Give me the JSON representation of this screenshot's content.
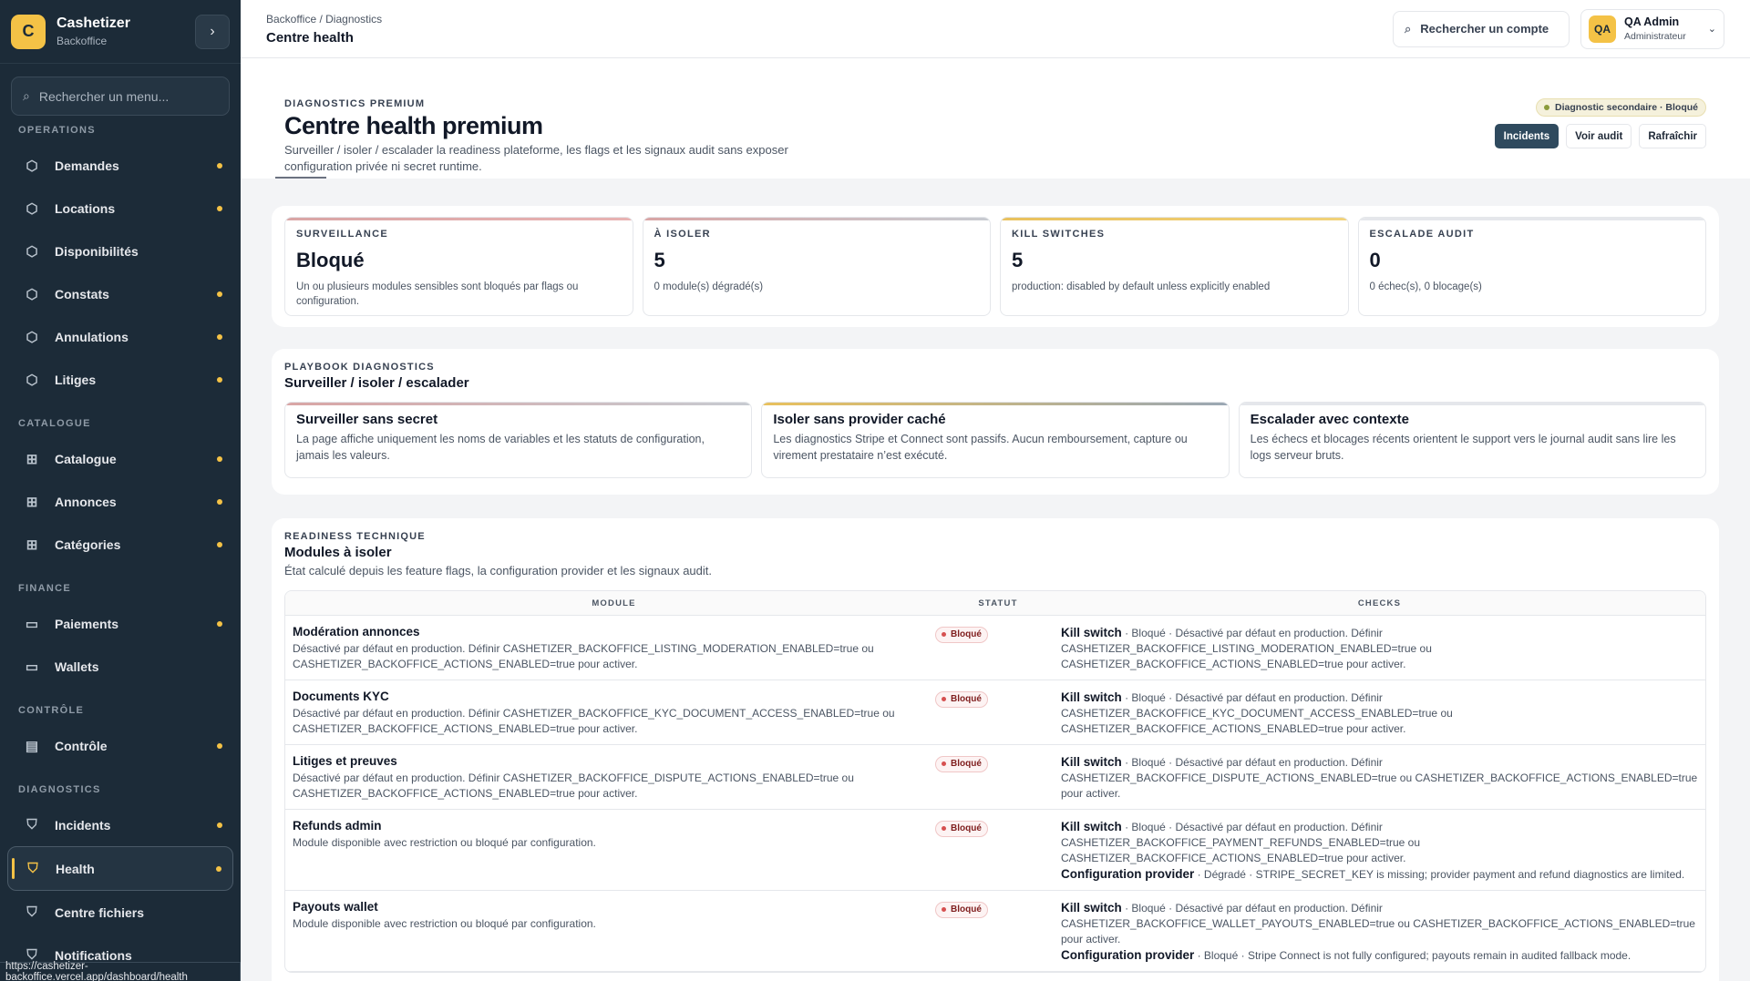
{
  "brand": {
    "initial": "C",
    "name": "Cashetizer",
    "sub": "Backoffice"
  },
  "sidebar": {
    "search_placeholder": "Rechercher un menu...",
    "sections": [
      {
        "title": "OPERATIONS",
        "items": [
          {
            "label": "Demandes",
            "icon": "cube-icon",
            "dot": true
          },
          {
            "label": "Locations",
            "icon": "cube-icon",
            "dot": true
          },
          {
            "label": "Disponibilités",
            "icon": "cube-icon",
            "dot": false
          },
          {
            "label": "Constats",
            "icon": "cube-icon",
            "dot": true
          },
          {
            "label": "Annulations",
            "icon": "cube-icon",
            "dot": true
          },
          {
            "label": "Litiges",
            "icon": "cube-icon",
            "dot": true
          }
        ]
      },
      {
        "title": "CATALOGUE",
        "items": [
          {
            "label": "Catalogue",
            "icon": "grid-icon",
            "dot": true
          },
          {
            "label": "Annonces",
            "icon": "grid-icon",
            "dot": true
          },
          {
            "label": "Catégories",
            "icon": "grid-icon",
            "dot": true
          }
        ]
      },
      {
        "title": "FINANCE",
        "items": [
          {
            "label": "Paiements",
            "icon": "card-icon",
            "dot": true
          },
          {
            "label": "Wallets",
            "icon": "card-icon",
            "dot": false
          }
        ]
      },
      {
        "title": "CONTRÔLE",
        "items": [
          {
            "label": "Contrôle",
            "icon": "document-icon",
            "dot": true
          }
        ]
      },
      {
        "title": "DIAGNOSTICS",
        "items": [
          {
            "label": "Incidents",
            "icon": "shield-icon",
            "dot": true
          },
          {
            "label": "Health",
            "icon": "shield-heart-icon",
            "dot": true,
            "active": true
          },
          {
            "label": "Centre fichiers",
            "icon": "shield-icon",
            "dot": false
          },
          {
            "label": "Notifications",
            "icon": "shield-icon",
            "dot": false
          }
        ]
      }
    ]
  },
  "status_url": "https://cashetizer-backoffice.vercel.app/dashboard/health",
  "topbar": {
    "breadcrumb": "Backoffice  /  Diagnostics",
    "title": "Centre health",
    "account_search": "Rechercher un compte",
    "user": {
      "initials": "QA",
      "name": "QA Admin",
      "role": "Administrateur"
    }
  },
  "hero": {
    "eyebrow": "DIAGNOSTICS PREMIUM",
    "title": "Centre health premium",
    "desc": "Surveiller / isoler / escalader la readiness plateforme, les flags et les signaux audit sans exposer configuration privée ni secret runtime.",
    "status_pill": "Diagnostic secondaire · Bloqué",
    "buttons": {
      "incidents": "Incidents",
      "audit": "Voir audit",
      "refresh": "Rafraîchir"
    }
  },
  "kpis": [
    {
      "label": "SURVEILLANCE",
      "value": "Bloqué",
      "note": "Un ou plusieurs modules sensibles sont bloqués par flags ou configuration."
    },
    {
      "label": "À ISOLER",
      "value": "5",
      "note": "0 module(s) dégradé(s)"
    },
    {
      "label": "KILL SWITCHES",
      "value": "5",
      "note": "production: disabled by default unless explicitly enabled"
    },
    {
      "label": "ESCALADE AUDIT",
      "value": "0",
      "note": "0 échec(s), 0 blocage(s)"
    }
  ],
  "playbook": {
    "eyebrow": "PLAYBOOK DIAGNOSTICS",
    "title": "Surveiller / isoler / escalader",
    "cards": [
      {
        "title": "Surveiller sans secret",
        "text": "La page affiche uniquement les noms de variables et les statuts de configuration, jamais les valeurs."
      },
      {
        "title": "Isoler sans provider caché",
        "text": "Les diagnostics Stripe et Connect sont passifs. Aucun remboursement, capture ou virement prestataire n’est exécuté."
      },
      {
        "title": "Escalader avec contexte",
        "text": "Les échecs et blocages récents orientent le support vers le journal audit sans lire les logs serveur bruts."
      }
    ]
  },
  "readiness": {
    "eyebrow": "READINESS TECHNIQUE",
    "title": "Modules à isoler",
    "desc": "État calculé depuis les feature flags, la configuration provider et les signaux audit.",
    "columns": [
      "MODULE",
      "STATUT",
      "CHECKS"
    ],
    "rows": [
      {
        "name": "Modération annonces",
        "desc": "Désactivé par défaut en production. Définir CASHETIZER_BACKOFFICE_LISTING_MODERATION_ENABLED=true ou CASHETIZER_BACKOFFICE_ACTIONS_ENABLED=true pour activer.",
        "status": "Bloqué",
        "checks": [
          {
            "title": "Kill switch",
            "text": " · Bloqué · Désactivé par défaut en production. Définir CASHETIZER_BACKOFFICE_LISTING_MODERATION_ENABLED=true ou CASHETIZER_BACKOFFICE_ACTIONS_ENABLED=true pour activer."
          }
        ]
      },
      {
        "name": "Documents KYC",
        "desc": "Désactivé par défaut en production. Définir CASHETIZER_BACKOFFICE_KYC_DOCUMENT_ACCESS_ENABLED=true ou CASHETIZER_BACKOFFICE_ACTIONS_ENABLED=true pour activer.",
        "status": "Bloqué",
        "checks": [
          {
            "title": "Kill switch",
            "text": " · Bloqué · Désactivé par défaut en production. Définir CASHETIZER_BACKOFFICE_KYC_DOCUMENT_ACCESS_ENABLED=true ou CASHETIZER_BACKOFFICE_ACTIONS_ENABLED=true pour activer."
          }
        ]
      },
      {
        "name": "Litiges et preuves",
        "desc": "Désactivé par défaut en production. Définir CASHETIZER_BACKOFFICE_DISPUTE_ACTIONS_ENABLED=true ou CASHETIZER_BACKOFFICE_ACTIONS_ENABLED=true pour activer.",
        "status": "Bloqué",
        "checks": [
          {
            "title": "Kill switch",
            "text": " · Bloqué · Désactivé par défaut en production. Définir CASHETIZER_BACKOFFICE_DISPUTE_ACTIONS_ENABLED=true ou CASHETIZER_BACKOFFICE_ACTIONS_ENABLED=true pour activer."
          }
        ]
      },
      {
        "name": "Refunds admin",
        "desc": "Module disponible avec restriction ou bloqué par configuration.",
        "status": "Bloqué",
        "checks": [
          {
            "title": "Kill switch",
            "text": " · Bloqué · Désactivé par défaut en production. Définir CASHETIZER_BACKOFFICE_PAYMENT_REFUNDS_ENABLED=true ou CASHETIZER_BACKOFFICE_ACTIONS_ENABLED=true pour activer."
          },
          {
            "title": "Configuration provider",
            "text": " · Dégradé · STRIPE_SECRET_KEY is missing; provider payment and refund diagnostics are limited."
          }
        ]
      },
      {
        "name": "Payouts wallet",
        "desc": "Module disponible avec restriction ou bloqué par configuration.",
        "status": "Bloqué",
        "checks": [
          {
            "title": "Kill switch",
            "text": " · Bloqué · Désactivé par défaut en production. Définir CASHETIZER_BACKOFFICE_WALLET_PAYOUTS_ENABLED=true ou CASHETIZER_BACKOFFICE_ACTIONS_ENABLED=true pour activer."
          },
          {
            "title": "Configuration provider",
            "text": " · Bloqué · Stripe Connect is not fully configured; payouts remain in audited fallback mode."
          }
        ]
      }
    ]
  }
}
